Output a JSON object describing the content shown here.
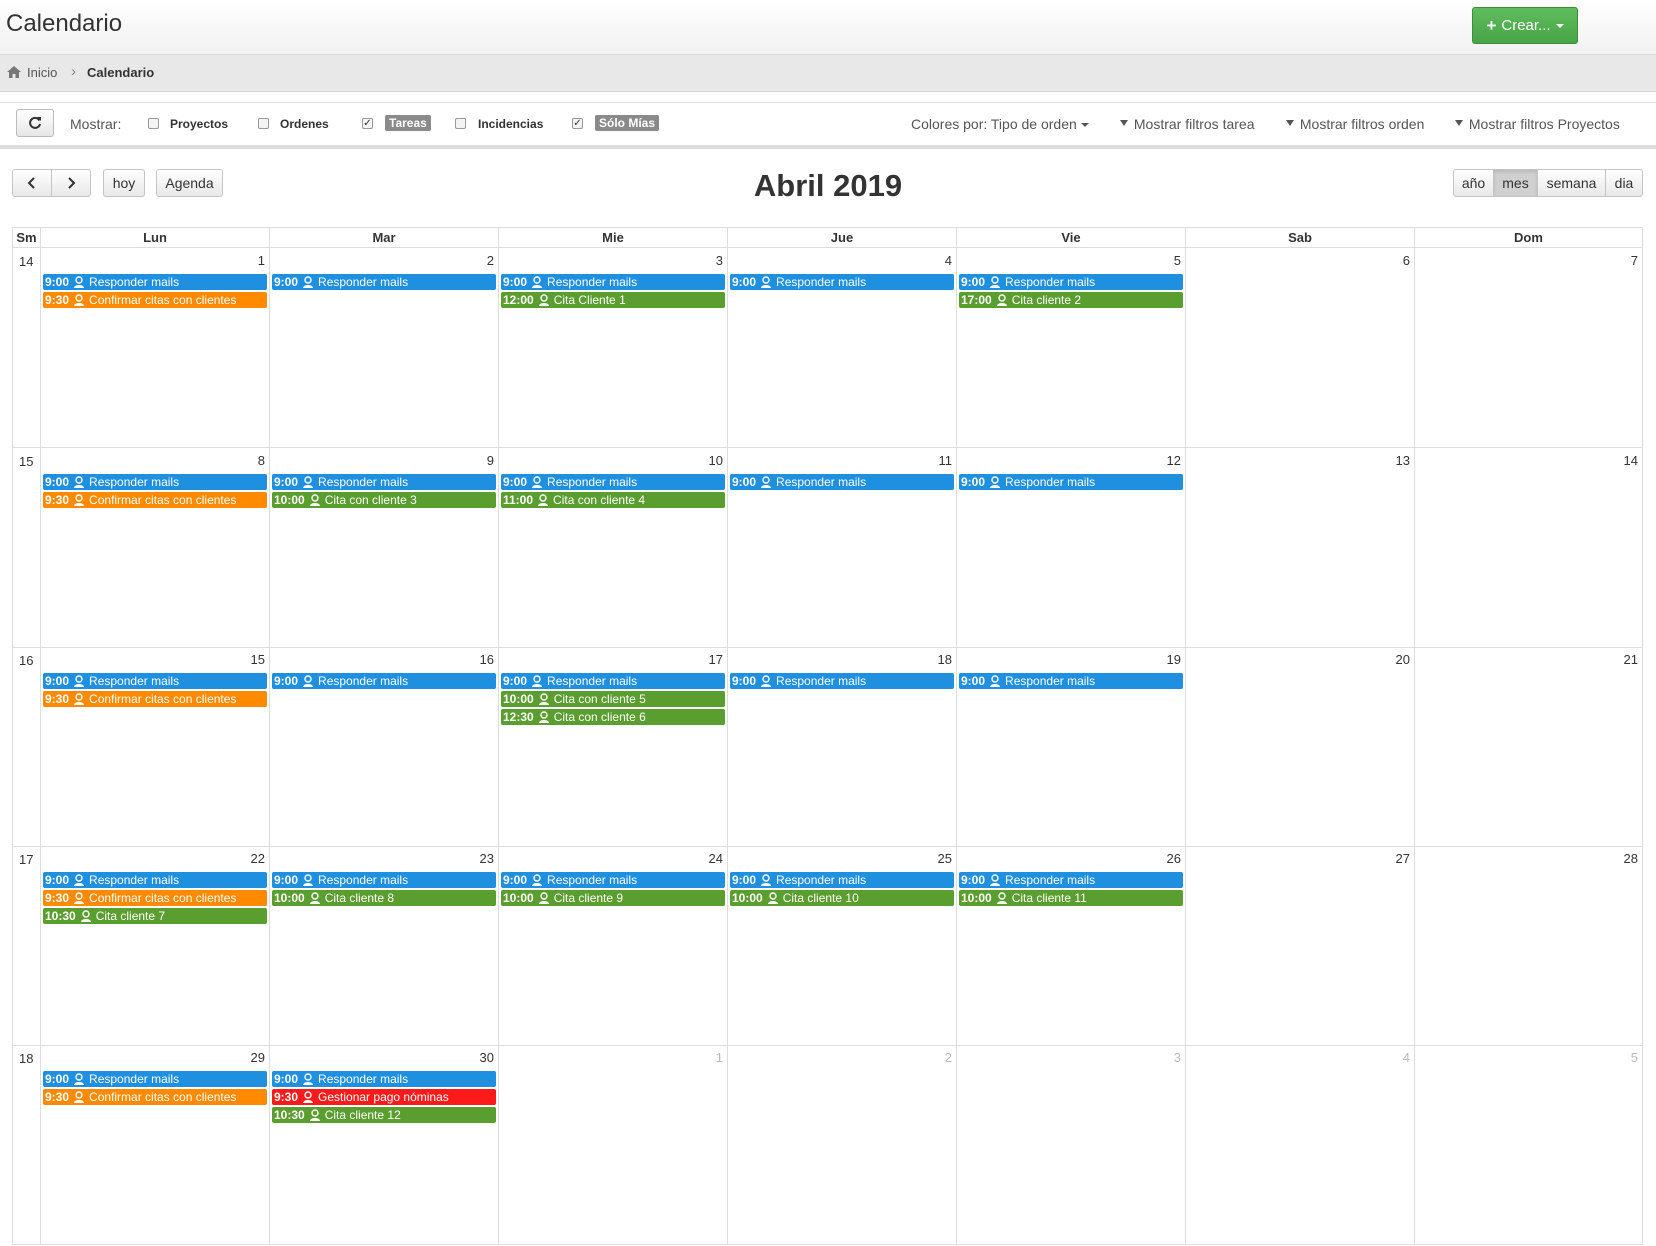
{
  "header": {
    "title": "Calendario",
    "create_label": "Crear..."
  },
  "breadcrumb": {
    "home": "Inicio",
    "current": "Calendario"
  },
  "toolbar": {
    "mostrar": "Mostrar:",
    "filters": [
      {
        "label": "Proyectos",
        "checked": false
      },
      {
        "label": "Ordenes",
        "checked": false
      },
      {
        "label": "Tareas",
        "checked": true
      },
      {
        "label": "Incidencias",
        "checked": false
      },
      {
        "label": "Sólo Mías",
        "checked": true
      }
    ],
    "colors_by": "Colores por: Tipo de orden",
    "filter_task": "Mostrar filtros tarea",
    "filter_order": "Mostrar filtros orden",
    "filter_projects": "Mostrar filtros Proyectos"
  },
  "nav": {
    "today": "hoy",
    "agenda": "Agenda"
  },
  "views": [
    {
      "label": "año",
      "active": false
    },
    {
      "label": "mes",
      "active": true
    },
    {
      "label": "semana",
      "active": false
    },
    {
      "label": "dia",
      "active": false
    }
  ],
  "calendar": {
    "title": "Abril 2019",
    "week_header": "Sm",
    "days": [
      "Lun",
      "Mar",
      "Mie",
      "Jue",
      "Vie",
      "Sab",
      "Dom"
    ],
    "colors": {
      "blue": "#1f8fe0",
      "orange": "#ff8a00",
      "green": "#5a9e2f",
      "red": "#ff1a1a"
    },
    "weeks": [
      {
        "num": "14",
        "days": [
          {
            "n": "1",
            "ev": [
              {
                "time": "9:00",
                "title": "Responder mails",
                "color": "blue"
              },
              {
                "time": "9:30",
                "title": "Confirmar citas con clientes",
                "color": "orange"
              }
            ]
          },
          {
            "n": "2",
            "ev": [
              {
                "time": "9:00",
                "title": "Responder mails",
                "color": "blue"
              }
            ]
          },
          {
            "n": "3",
            "ev": [
              {
                "time": "9:00",
                "title": "Responder mails",
                "color": "blue"
              },
              {
                "time": "12:00",
                "title": "Cita Cliente 1",
                "color": "green"
              }
            ]
          },
          {
            "n": "4",
            "ev": [
              {
                "time": "9:00",
                "title": "Responder mails",
                "color": "blue"
              }
            ]
          },
          {
            "n": "5",
            "ev": [
              {
                "time": "9:00",
                "title": "Responder mails",
                "color": "blue"
              },
              {
                "time": "17:00",
                "title": "Cita cliente 2",
                "color": "green"
              }
            ]
          },
          {
            "n": "6",
            "ev": []
          },
          {
            "n": "7",
            "ev": []
          }
        ]
      },
      {
        "num": "15",
        "days": [
          {
            "n": "8",
            "ev": [
              {
                "time": "9:00",
                "title": "Responder mails",
                "color": "blue"
              },
              {
                "time": "9:30",
                "title": "Confirmar citas con clientes",
                "color": "orange"
              }
            ]
          },
          {
            "n": "9",
            "ev": [
              {
                "time": "9:00",
                "title": "Responder mails",
                "color": "blue"
              },
              {
                "time": "10:00",
                "title": "Cita con cliente 3",
                "color": "green"
              }
            ]
          },
          {
            "n": "10",
            "ev": [
              {
                "time": "9:00",
                "title": "Responder mails",
                "color": "blue"
              },
              {
                "time": "11:00",
                "title": "Cita con cliente 4",
                "color": "green"
              }
            ]
          },
          {
            "n": "11",
            "ev": [
              {
                "time": "9:00",
                "title": "Responder mails",
                "color": "blue"
              }
            ]
          },
          {
            "n": "12",
            "ev": [
              {
                "time": "9:00",
                "title": "Responder mails",
                "color": "blue"
              }
            ]
          },
          {
            "n": "13",
            "ev": []
          },
          {
            "n": "14",
            "ev": []
          }
        ]
      },
      {
        "num": "16",
        "days": [
          {
            "n": "15",
            "ev": [
              {
                "time": "9:00",
                "title": "Responder mails",
                "color": "blue"
              },
              {
                "time": "9:30",
                "title": "Confirmar citas con clientes",
                "color": "orange"
              }
            ]
          },
          {
            "n": "16",
            "ev": [
              {
                "time": "9:00",
                "title": "Responder mails",
                "color": "blue"
              }
            ]
          },
          {
            "n": "17",
            "ev": [
              {
                "time": "9:00",
                "title": "Responder mails",
                "color": "blue"
              },
              {
                "time": "10:00",
                "title": "Cita con cliente 5",
                "color": "green"
              },
              {
                "time": "12:30",
                "title": "Cita con cliente 6",
                "color": "green"
              }
            ]
          },
          {
            "n": "18",
            "ev": [
              {
                "time": "9:00",
                "title": "Responder mails",
                "color": "blue"
              }
            ]
          },
          {
            "n": "19",
            "ev": [
              {
                "time": "9:00",
                "title": "Responder mails",
                "color": "blue"
              }
            ]
          },
          {
            "n": "20",
            "ev": []
          },
          {
            "n": "21",
            "ev": []
          }
        ]
      },
      {
        "num": "17",
        "days": [
          {
            "n": "22",
            "ev": [
              {
                "time": "9:00",
                "title": "Responder mails",
                "color": "blue"
              },
              {
                "time": "9:30",
                "title": "Confirmar citas con clientes",
                "color": "orange"
              },
              {
                "time": "10:30",
                "title": "Cita cliente 7",
                "color": "green"
              }
            ]
          },
          {
            "n": "23",
            "ev": [
              {
                "time": "9:00",
                "title": "Responder mails",
                "color": "blue"
              },
              {
                "time": "10:00",
                "title": "Cita cliente 8",
                "color": "green"
              }
            ]
          },
          {
            "n": "24",
            "ev": [
              {
                "time": "9:00",
                "title": "Responder mails",
                "color": "blue"
              },
              {
                "time": "10:00",
                "title": "Cita cliente 9",
                "color": "green"
              }
            ]
          },
          {
            "n": "25",
            "ev": [
              {
                "time": "9:00",
                "title": "Responder mails",
                "color": "blue"
              },
              {
                "time": "10:00",
                "title": "Cita cliente 10",
                "color": "green"
              }
            ]
          },
          {
            "n": "26",
            "ev": [
              {
                "time": "9:00",
                "title": "Responder mails",
                "color": "blue"
              },
              {
                "time": "10:00",
                "title": "Cita cliente 11",
                "color": "green"
              }
            ]
          },
          {
            "n": "27",
            "ev": []
          },
          {
            "n": "28",
            "ev": []
          }
        ]
      },
      {
        "num": "18",
        "days": [
          {
            "n": "29",
            "ev": [
              {
                "time": "9:00",
                "title": "Responder mails",
                "color": "blue"
              },
              {
                "time": "9:30",
                "title": "Confirmar citas con clientes",
                "color": "orange"
              }
            ]
          },
          {
            "n": "30",
            "ev": [
              {
                "time": "9:00",
                "title": "Responder mails",
                "color": "blue"
              },
              {
                "time": "9:30",
                "title": "Gestionar pago nóminas",
                "color": "red"
              },
              {
                "time": "10:30",
                "title": "Cita cliente 12",
                "color": "green"
              }
            ]
          },
          {
            "n": "1",
            "other": true,
            "ev": []
          },
          {
            "n": "2",
            "other": true,
            "ev": []
          },
          {
            "n": "3",
            "other": true,
            "ev": []
          },
          {
            "n": "4",
            "other": true,
            "ev": []
          },
          {
            "n": "5",
            "other": true,
            "ev": []
          }
        ]
      }
    ]
  }
}
